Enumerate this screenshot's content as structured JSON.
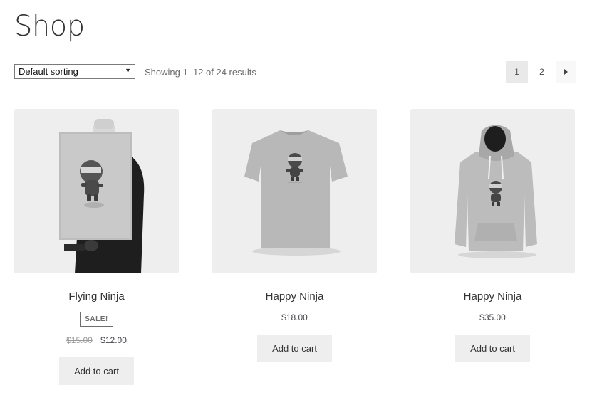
{
  "page": {
    "title": "Shop"
  },
  "toolbar": {
    "sort_selected": "Default sorting",
    "result_count": "Showing 1–12 of 24 results"
  },
  "pagination": {
    "pages": [
      "1",
      "2"
    ],
    "current": "1"
  },
  "products": [
    {
      "name": "Flying Ninja",
      "sale_badge": "SALE!",
      "old_price": "$15.00",
      "price": "$12.00",
      "button": "Add to cart",
      "image": "poster-image"
    },
    {
      "name": "Happy Ninja",
      "price": "$18.00",
      "button": "Add to cart",
      "image": "tshirt-image"
    },
    {
      "name": "Happy Ninja",
      "price": "$35.00",
      "button": "Add to cart",
      "image": "hoodie-image"
    }
  ]
}
